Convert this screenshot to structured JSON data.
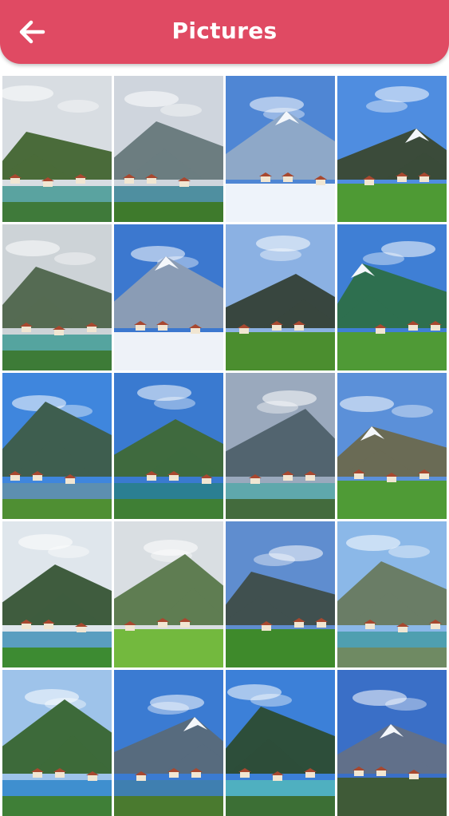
{
  "appbar": {
    "title": "Pictures",
    "color": "#e04a63",
    "back_icon": "arrow-left-icon"
  },
  "photos": [
    {
      "id": "riverside-village",
      "sky": "#d8dde2",
      "mountain": "#4a6b3a",
      "snow": false,
      "ground": "#3f7a3a",
      "water": "#5aa3a0"
    },
    {
      "id": "cloudy-river-tree",
      "sky": "#cfd5dd",
      "mountain": "#6c7d80",
      "snow": false,
      "ground": "#3e7a2c",
      "water": "#4f8fa0"
    },
    {
      "id": "observation-deck",
      "sky": "#4f86d4",
      "mountain": "#8ea8c8",
      "snow": true,
      "ground": "#eef3fa",
      "water": ""
    },
    {
      "id": "alpine-chalets",
      "sky": "#4f8de0",
      "mountain": "#3b4b3a",
      "snow": true,
      "ground": "#4e9a34",
      "water": ""
    },
    {
      "id": "misty-chalets",
      "sky": "#cdd3d7",
      "mountain": "#556b53",
      "snow": false,
      "ground": "#3d7b37",
      "water": "#55a49f"
    },
    {
      "id": "snowy-peaks",
      "sky": "#3c78cf",
      "mountain": "#8a9cb5",
      "snow": true,
      "ground": "#eef2f8",
      "water": ""
    },
    {
      "id": "cloud-valley",
      "sky": "#8bb1e3",
      "mountain": "#38463f",
      "snow": false,
      "ground": "#4b8e2f",
      "water": ""
    },
    {
      "id": "valley-town",
      "sky": "#3f7fd5",
      "mountain": "#2e6f4f",
      "snow": true,
      "ground": "#4f9a36",
      "water": ""
    },
    {
      "id": "meadow-lake-view",
      "sky": "#3f86dd",
      "mountain": "#3e5e4f",
      "snow": false,
      "ground": "#4f8f33",
      "water": "#5d8fb0"
    },
    {
      "id": "canal-town",
      "sky": "#3a7ad0",
      "mountain": "#3f6a3e",
      "snow": false,
      "ground": "#3f7f35",
      "water": "#2b7f92"
    },
    {
      "id": "river-through-town",
      "sky": "#9aa9bd",
      "mountain": "#52646f",
      "snow": false,
      "ground": "#436b3d",
      "water": "#5fa8ac"
    },
    {
      "id": "cliffs-hut",
      "sky": "#5b90d9",
      "mountain": "#6a6b55",
      "snow": true,
      "ground": "#4f9b36",
      "water": ""
    },
    {
      "id": "lake-shore",
      "sky": "#dfe6ec",
      "mountain": "#3f5c3e",
      "snow": false,
      "ground": "#3d8b32",
      "water": "#5a9ec0"
    },
    {
      "id": "castle-garden",
      "sky": "#d9dee2",
      "mountain": "#5f7d52",
      "snow": false,
      "ground": "#73b93e",
      "water": ""
    },
    {
      "id": "paraglider-sky",
      "sky": "#5f8dcf",
      "mountain": "#40504f",
      "snow": false,
      "ground": "#3e8a2b",
      "water": ""
    },
    {
      "id": "tandem-paragliding",
      "sky": "#8bb8e8",
      "mountain": "#6a7d66",
      "snow": false,
      "ground": "#6f8a63",
      "water": "#4f9fb0"
    },
    {
      "id": "lake-village",
      "sky": "#9ec3ea",
      "mountain": "#3d6a3a",
      "snow": false,
      "ground": "#3f7f37",
      "water": "#3f8fcf"
    },
    {
      "id": "snowy-range-lake",
      "sky": "#3b7bd2",
      "mountain": "#576b7e",
      "snow": true,
      "ground": "#4a7a2f",
      "water": "#3f7fb0"
    },
    {
      "id": "blue-lake",
      "sky": "#3c80d8",
      "mountain": "#2d4e3a",
      "snow": false,
      "ground": "#3c6f35",
      "water": "#4fb0c0"
    },
    {
      "id": "alpine-horizon",
      "sky": "#3a6fc7",
      "mountain": "#61708a",
      "snow": true,
      "ground": "#3f5a37",
      "water": ""
    }
  ]
}
